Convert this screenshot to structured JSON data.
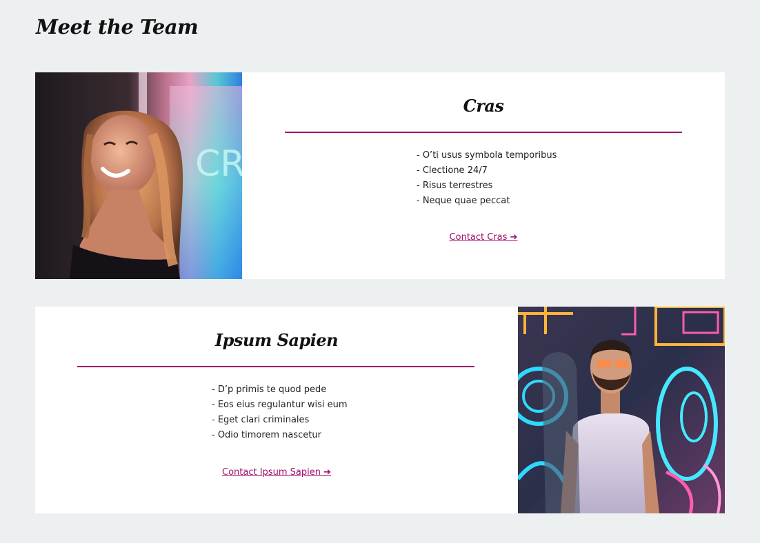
{
  "page": {
    "title": "Meet the Team"
  },
  "members": [
    {
      "name": "Cras",
      "skills": [
        "- O’ti usus symbola temporibus",
        "- Clectione 24/7",
        "- Risus terrestres",
        "- Neque quae peccat"
      ],
      "contact_label": "Contact Cras ➔"
    },
    {
      "name": "Ipsum Sapien",
      "skills": [
        "- D’p primis te quod pede",
        "- Eos eius regulantur wisi eum",
        "- Eget clari criminales",
        "- Odio timorem nascetur"
      ],
      "contact_label": "Contact Ipsum Sapien ➔"
    }
  ],
  "colors": {
    "accent": "#a0106a",
    "background": "#edf0f1",
    "card": "#ffffff"
  }
}
